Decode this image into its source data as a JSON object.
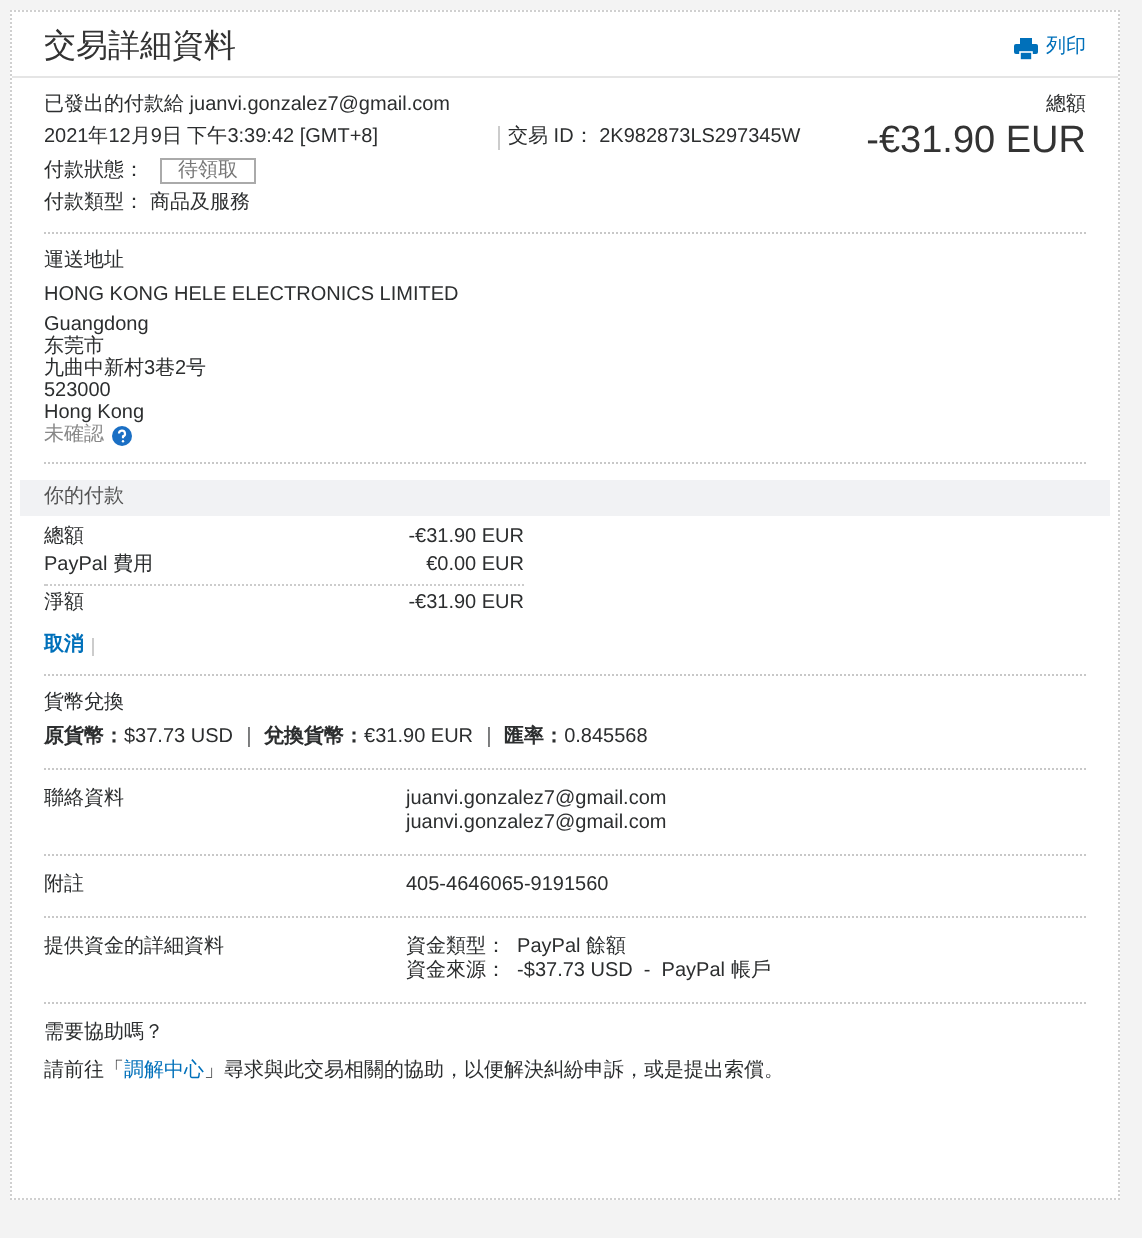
{
  "title": "交易詳細資料",
  "print_link": "列印",
  "summary": {
    "sent_to_label": "已發出的付款給",
    "sent_to": "juanvi.gonzalez7@gmail.com",
    "datetime": "2021年12月9日 下午3:39:42 [GMT+8]",
    "txn_id_label": "交易 ID：",
    "txn_id": "2K982873LS297345W",
    "status_label": "付款狀態：",
    "status": "待領取",
    "type_label": "付款類型：",
    "type": "商品及服務",
    "total_label": "總額",
    "total": "-€31.90 EUR"
  },
  "shipping": {
    "heading": "運送地址",
    "lines": [
      "HONG KONG HELE ELECTRONICS LIMITED",
      "Guangdong",
      "东莞市",
      "九曲中新村3巷2号",
      "523000",
      "Hong Kong"
    ],
    "unconfirmed": "未確認"
  },
  "payment": {
    "heading": "你的付款",
    "rows": [
      {
        "label": "總額",
        "value": "-€31.90 EUR"
      },
      {
        "label": "PayPal 費用",
        "value": "€0.00 EUR"
      },
      {
        "label": "淨額",
        "value": "-€31.90 EUR"
      }
    ],
    "cancel": "取消"
  },
  "conversion": {
    "heading": "貨幣兌換",
    "text": "**原貨幣：**$37.73 USD ｜ **兌換貨幣：**€31.90 EUR ｜ **匯率：**0.845568"
  },
  "details": [
    {
      "label": "聯絡資料",
      "lines": [
        "juanvi.gonzalez7@gmail.com",
        "juanvi.gonzalez7@gmail.com"
      ]
    },
    {
      "label": "附註",
      "lines": [
        "405-4646065-9191560"
      ]
    },
    {
      "label": "提供資金的詳細資料",
      "lines": [
        "資金類型：  PayPal 餘額",
        "資金來源：  -$37.73 USD  -  PayPal 帳戶"
      ]
    }
  ],
  "help": {
    "heading": "需要協助嗎？",
    "before": "請前往「",
    "link": "調解中心",
    "after": "」尋求與此交易相關的協助，以便解決糾紛申訴，或是提出索償。"
  }
}
